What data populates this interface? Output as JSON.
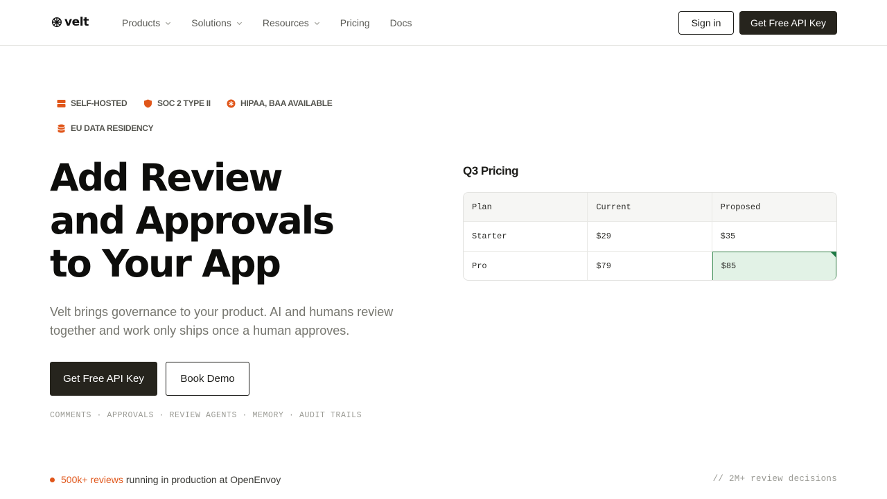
{
  "nav": {
    "logo_text": "velt",
    "links": [
      {
        "label": "Products",
        "dropdown": true
      },
      {
        "label": "Solutions",
        "dropdown": true
      },
      {
        "label": "Resources",
        "dropdown": true
      },
      {
        "label": "Pricing",
        "dropdown": false
      },
      {
        "label": "Docs",
        "dropdown": false
      }
    ],
    "signin_label": "Sign in",
    "cta_label": "Get Free API Key"
  },
  "badges": [
    {
      "icon": "server-icon",
      "label": "SELF-HOSTED"
    },
    {
      "icon": "shield-icon",
      "label": "SOC 2 TYPE II"
    },
    {
      "icon": "medical-badge-icon",
      "label": "HIPAA, BAA AVAILABLE"
    },
    {
      "icon": "database-icon",
      "label": "EU DATA RESIDENCY"
    }
  ],
  "hero": {
    "title_lines": [
      "Add Review",
      "and Approvals",
      "to Your App"
    ],
    "subtitle": "Velt brings governance to your product. AI and humans review together and work only ships once a human approves.",
    "primary_cta": "Get Free API Key",
    "secondary_cta": "Book Demo",
    "features": "COMMENTS · APPROVALS · REVIEW AGENTS · MEMORY · AUDIT TRAILS"
  },
  "pricing_panel": {
    "title": "Q3 Pricing",
    "columns": [
      "Plan",
      "Current",
      "Proposed"
    ],
    "rows": [
      [
        "Starter",
        "$29",
        "$35"
      ],
      [
        "Pro",
        "$79",
        "$85"
      ]
    ],
    "highlighted_cell": "Pro-Proposed"
  },
  "footer": {
    "stat_highlight": "500k+ reviews",
    "stat_rest": "running in production at OpenEnvoy",
    "comment": "// 2M+ review decisions"
  },
  "colors": {
    "accent": "#e0561a",
    "dark": "#26241d",
    "highlight_bg": "#e2f2e6",
    "highlight_border": "#4b9a63"
  }
}
